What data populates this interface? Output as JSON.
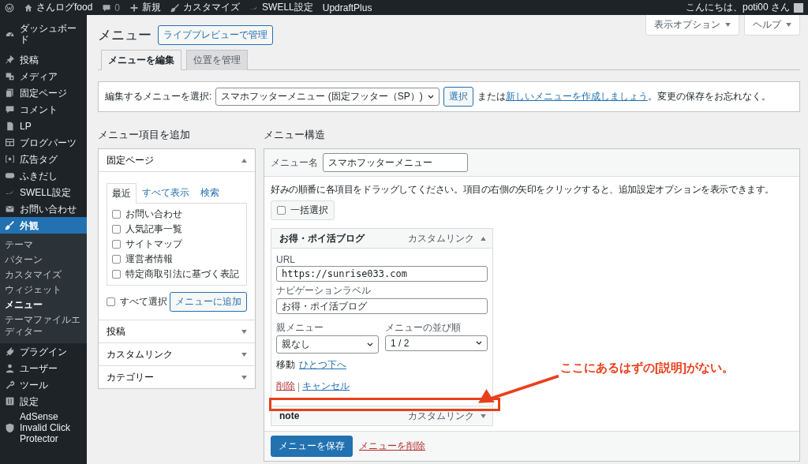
{
  "admin_bar": {
    "items": [
      {
        "kind": "site",
        "label": "さんログfood"
      },
      {
        "kind": "comments",
        "label": "0"
      },
      {
        "kind": "new",
        "label": "新規"
      },
      {
        "kind": "customize",
        "label": "カスタマイズ"
      },
      {
        "kind": "swell",
        "label": "SWELL設定"
      },
      {
        "kind": "plain",
        "label": "UpdraftPlus"
      }
    ],
    "greeting": "こんにちは、poti00 さん"
  },
  "sidebar": {
    "items": [
      {
        "label": "ダッシュボード",
        "selected": false
      },
      {
        "label": "投稿",
        "selected": false
      },
      {
        "label": "メディア",
        "selected": false
      },
      {
        "label": "固定ページ",
        "selected": false
      },
      {
        "label": "コメント",
        "selected": false
      },
      {
        "label": "LP",
        "selected": false
      },
      {
        "label": "ブログパーツ",
        "selected": false
      },
      {
        "label": "広告タグ",
        "selected": false
      },
      {
        "label": "ふきだし",
        "selected": false
      },
      {
        "label": "SWELL設定",
        "selected": false
      },
      {
        "label": "お問い合わせ",
        "selected": false
      },
      {
        "label": "外観",
        "selected": true,
        "children": [
          {
            "label": "テーマ",
            "selected": false
          },
          {
            "label": "パターン",
            "selected": false
          },
          {
            "label": "カスタマイズ",
            "selected": false
          },
          {
            "label": "ウィジェット",
            "selected": false
          },
          {
            "label": "メニュー",
            "selected": true
          },
          {
            "label": "テーマファイルエディター",
            "selected": false
          }
        ]
      },
      {
        "label": "プラグイン",
        "selected": false
      },
      {
        "label": "ユーザー",
        "selected": false
      },
      {
        "label": "ツール",
        "selected": false
      },
      {
        "label": "設定",
        "selected": false
      },
      {
        "label": "AdSense Invalid Click Protector",
        "selected": false
      }
    ]
  },
  "screen_meta": [
    {
      "label": "表示オプション"
    },
    {
      "label": "ヘルプ"
    }
  ],
  "page": {
    "title": "メニュー",
    "preview_button": "ライブプレビューで管理",
    "tabs": [
      {
        "label": "メニューを編集",
        "selected": true
      },
      {
        "label": "位置を管理",
        "selected": false
      }
    ]
  },
  "select_bar": {
    "label": "編集するメニューを選択:",
    "value": "スマホフッターメニュー (固定フッター（SP）)",
    "button": "選択",
    "prefix": "または",
    "link": "新しいメニューを作成しましょう",
    "suffix": "。変更の保存をお忘れなく。"
  },
  "add_items": {
    "title": "メニュー項目を追加",
    "sections": [
      {
        "title": "固定ページ",
        "expanded": true,
        "tabs": [
          {
            "label": "最近",
            "selected": true
          },
          {
            "label": "すべて表示",
            "selected": false
          },
          {
            "label": "検索",
            "selected": false
          }
        ],
        "items": [
          {
            "label": "お問い合わせ",
            "checked": false
          },
          {
            "label": "人気記事一覧",
            "checked": false
          },
          {
            "label": "サイトマップ",
            "checked": false
          },
          {
            "label": "運営者情報",
            "checked": false
          },
          {
            "label": "特定商取引法に基づく表記",
            "checked": false
          }
        ],
        "select_all": {
          "label": "すべて選択",
          "checked": false
        },
        "button": "メニューに追加"
      },
      {
        "title": "投稿",
        "expanded": false
      },
      {
        "title": "カスタムリンク",
        "expanded": false
      },
      {
        "title": "カテゴリー",
        "expanded": false
      }
    ]
  },
  "structure": {
    "title": "メニュー構造",
    "name_label": "メニュー名",
    "name_value": "スマホフッターメニュー",
    "instructions": "好みの順番に各項目をドラッグしてください。項目の右側の矢印をクリックすると、追加設定オプションを表示できます。",
    "bulk_select": {
      "label": "一括選択",
      "checked": false
    },
    "items": [
      {
        "title": "お得・ポイ活ブログ",
        "type": "カスタムリンク",
        "expanded": true,
        "settings": {
          "url_label": "URL",
          "url": "https://sunrise033.com",
          "nav_label_label": "ナビゲーションラベル",
          "nav_label": "お得・ポイ活ブログ",
          "parent_label": "親メニュー",
          "parent_value": "親なし",
          "order_label": "メニューの並び順",
          "order_value": "1 / 2",
          "move_label": "移動",
          "move_link": "ひとつ下へ",
          "delete": "削除",
          "separator": "|",
          "cancel": "キャンセル"
        }
      },
      {
        "title": "note",
        "type": "カスタムリンク",
        "expanded": false
      }
    ],
    "save_button": "メニューを保存",
    "delete_link": "メニューを削除"
  },
  "annotation": {
    "text": "ここにあるはずの[説明]がない。"
  }
}
